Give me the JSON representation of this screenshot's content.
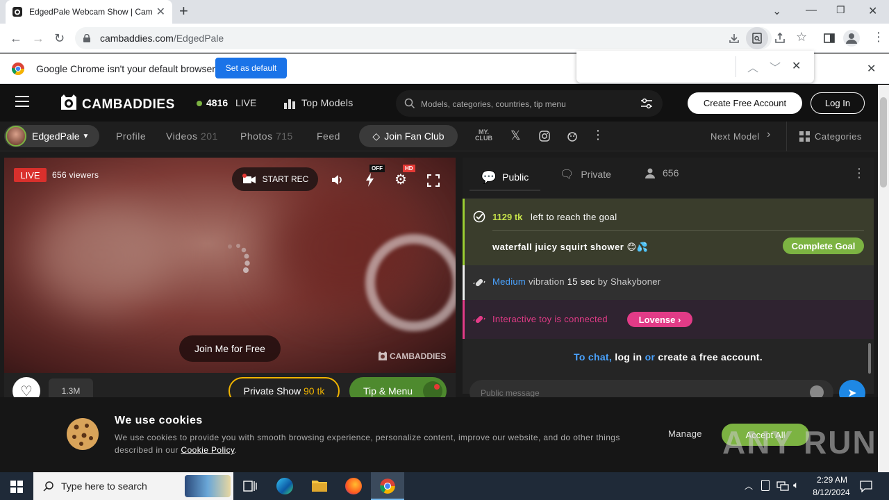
{
  "browser": {
    "tab_title": "EdgedPale Webcam Show | Cam",
    "url_domain": "cambaddies.com",
    "url_path": "/EdgedPale",
    "infobar_text": "Google Chrome isn't your default browser",
    "set_default_label": "Set as default"
  },
  "header": {
    "logo": "CAMBADDIES",
    "live_count": "4816",
    "live_label": "LIVE",
    "top_models": "Top Models",
    "search_placeholder": "Models, categories, countries, tip menu",
    "create_account": "Create Free Account",
    "login": "Log In"
  },
  "subnav": {
    "model_name": "EdgedPale",
    "profile": "Profile",
    "videos": "Videos",
    "videos_count": "201",
    "photos": "Photos",
    "photos_count": "715",
    "feed": "Feed",
    "fan_club": "Join Fan Club",
    "myclub_top": "MY.",
    "myclub_bottom": "CLUB",
    "next_model": "Next Model",
    "categories": "Categories"
  },
  "video": {
    "live_badge": "LIVE",
    "viewers": "656 viewers",
    "start_rec": "START REC",
    "off_badge": "OFF",
    "hd_badge": "HD",
    "join_free": "Join Me for Free",
    "watermark": "CAMBADDIES",
    "likes": "1.3M",
    "private_show": "Private Show",
    "private_price": "90 tk",
    "tip_menu": "Tip & Menu"
  },
  "chat": {
    "tab_public": "Public",
    "tab_private": "Private",
    "user_count": "656",
    "goal_tokens": "1129 tk",
    "goal_left": "left to reach the goal",
    "goal_name": "waterfall juicy squirt shower 😊💦",
    "complete_goal": "Complete Goal",
    "vib_level": "Medium",
    "vib_word": "vibration",
    "vib_duration": "15 sec",
    "vib_by": "by",
    "vib_user": "Shakyboner",
    "toy_text": "Interactive toy is connected",
    "lovense": "Lovense",
    "msg_to_chat": "To chat,",
    "msg_login": "log in",
    "msg_or": "or",
    "msg_create": "create a free account.",
    "input_placeholder": "Public message"
  },
  "cookie": {
    "title": "We use cookies",
    "body": "We use cookies to provide you with smooth browsing experience, personalize content, improve our website, and do other things described in our",
    "policy": "Cookie Policy",
    "policy_end": ".",
    "manage": "Manage",
    "accept": "Accept All"
  },
  "watermark": "ANY RUN",
  "taskbar": {
    "search": "Type here to search",
    "time": "2:29 AM",
    "date": "8/12/2024"
  },
  "colors": {
    "accent_green": "#7cb342",
    "goal_yellow": "#c6e24a",
    "live_red": "#d9302c",
    "lovense_pink": "#e23b87",
    "link_blue": "#4aa3ff",
    "price_orange": "#f0b400"
  }
}
